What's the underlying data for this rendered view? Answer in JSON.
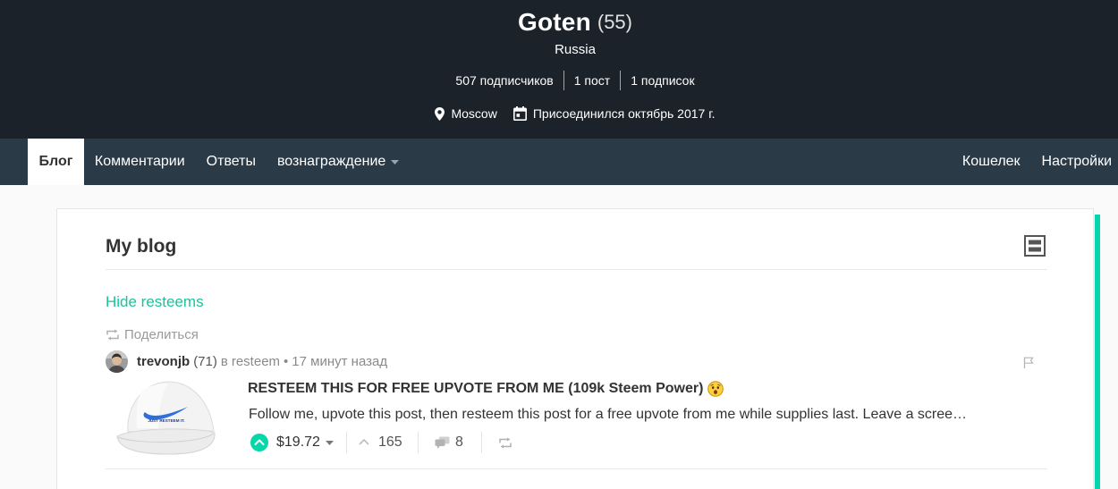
{
  "header": {
    "name": "Goten",
    "reputation": "(55)",
    "country": "Russia",
    "stats": [
      "507 подписчиков",
      "1 пост",
      "1 подписок"
    ],
    "location": {
      "icon": "map-pin-icon",
      "text": "Moscow"
    },
    "joined": {
      "icon": "calendar-icon",
      "text": "Присоединился октябрь 2017 г."
    }
  },
  "nav": {
    "tabs": [
      {
        "label": "Блог",
        "active": true
      },
      {
        "label": "Комментарии",
        "active": false
      },
      {
        "label": "Ответы",
        "active": false
      },
      {
        "label": "вознаграждение",
        "active": false,
        "dropdown_icon": "caret-down-icon"
      }
    ],
    "right": [
      {
        "label": "Кошелек"
      },
      {
        "label": "Настройки"
      }
    ]
  },
  "blog": {
    "heading": "My blog",
    "layout_toggle_icon": "list-layout-icon",
    "hide_resteems": "Hide resteems",
    "posts": [
      {
        "resteem_icon": "resteem-icon",
        "resteem_label": "Поделиться",
        "author": "trevonjb",
        "author_rep": "(71)",
        "category_prefix": "в",
        "category": "resteem",
        "separator": "•",
        "time": "17 минут назад",
        "flag_icon": "flag-icon",
        "thumbnail": {
          "caption": "JUST RESTEEM IT."
        },
        "title": "RESTEEM THIS FOR FREE UPVOTE FROM ME (109k Steem Power)",
        "title_emoji_icon": "astonished-face-emoji-icon",
        "body": "Follow me, upvote this post, then resteem this post for a free upvote from me while supplies last. Leave a scree…",
        "payout": "$19.72",
        "votes": "165",
        "comments": "8"
      }
    ]
  },
  "colors": {
    "header_bg": "#1b222a",
    "nav_bg": "#2a3a47",
    "page_bg": "#fafafa",
    "accent": "#06d6a9",
    "accent_text": "#19c49a"
  }
}
